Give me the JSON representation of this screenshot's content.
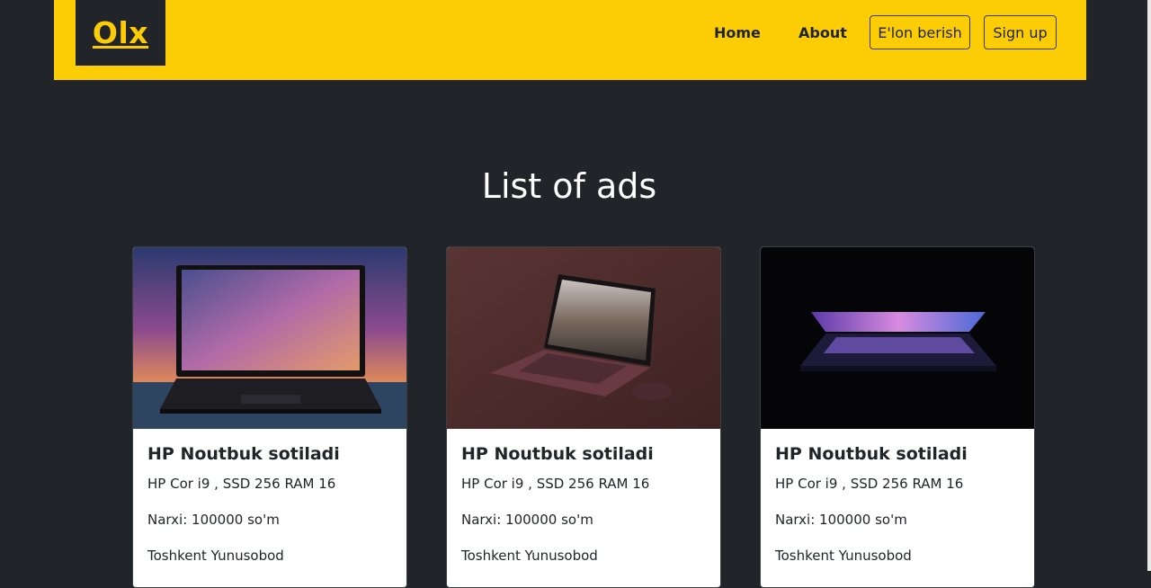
{
  "navbar": {
    "logo": "Olx",
    "links": [
      "Home",
      "About"
    ],
    "buttons": [
      "E'lon berish",
      "Sign up"
    ]
  },
  "page_title": "List of ads",
  "ads": [
    {
      "title": "HP Noutbuk sotiladi",
      "specs": "HP Cor i9 , SSD 256 RAM 16",
      "price": "Narxi: 100000 so'm",
      "location": "Toshkent Yunusobod",
      "image": "laptop-galaxy-photo"
    },
    {
      "title": "HP Noutbuk sotiladi",
      "specs": "HP Cor i9 , SSD 256 RAM 16",
      "price": "Narxi: 100000 so'm",
      "location": "Toshkent Yunusobod",
      "image": "laptop-maroon-photo"
    },
    {
      "title": "HP Noutbuk sotiladi",
      "specs": "HP Cor i9 , SSD 256 RAM 16",
      "price": "Narxi: 100000 so'm",
      "location": "Toshkent Yunusobod",
      "image": "laptop-dark-glow-photo"
    }
  ],
  "colors": {
    "brand_yellow": "#fccd04",
    "background": "#212529",
    "card_background": "#ffffff"
  }
}
